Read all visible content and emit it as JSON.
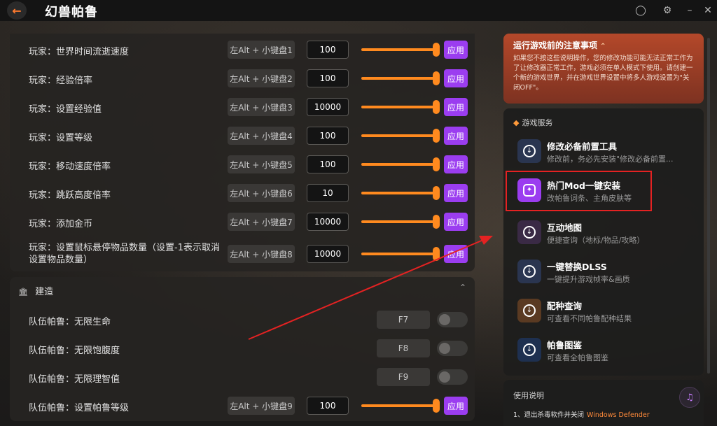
{
  "app": {
    "title": "幻兽帕鲁",
    "back_icon": "arrow-left-icon"
  },
  "player_rows": [
    {
      "label": "玩家：世界时间流逝速度",
      "hotkey": "左Alt + 小键盘1",
      "value": "100",
      "apply": "应用"
    },
    {
      "label": "玩家：经验倍率",
      "hotkey": "左Alt + 小键盘2",
      "value": "100",
      "apply": "应用"
    },
    {
      "label": "玩家：设置经验值",
      "hotkey": "左Alt + 小键盘3",
      "value": "10000",
      "apply": "应用"
    },
    {
      "label": "玩家：设置等级",
      "hotkey": "左Alt + 小键盘4",
      "value": "100",
      "apply": "应用"
    },
    {
      "label": "玩家：移动速度倍率",
      "hotkey": "左Alt + 小键盘5",
      "value": "100",
      "apply": "应用"
    },
    {
      "label": "玩家：跳跃高度倍率",
      "hotkey": "左Alt + 小键盘6",
      "value": "10",
      "apply": "应用"
    },
    {
      "label": "玩家：添加金币",
      "hotkey": "左Alt + 小键盘7",
      "value": "10000",
      "apply": "应用"
    },
    {
      "label": "玩家：设置鼠标悬停物品数量（设置-1表示取消设置物品数量）",
      "hotkey": "左Alt + 小键盘8",
      "value": "10000",
      "apply": "应用"
    }
  ],
  "build_section": {
    "title": "建造",
    "rows": [
      {
        "label": "队伍帕鲁：无限生命",
        "hotkey": "F7"
      },
      {
        "label": "队伍帕鲁：无限饱腹度",
        "hotkey": "F8"
      },
      {
        "label": "队伍帕鲁：无限理智值",
        "hotkey": "F9"
      }
    ],
    "level_row": {
      "label": "队伍帕鲁：设置帕鲁等级",
      "hotkey": "左Alt + 小键盘9",
      "value": "100",
      "apply": "应用"
    }
  },
  "notice": {
    "title": "运行游戏前的注意事项",
    "text": "如果您不按这些说明操作，您的修改功能可能无法正常工作为了让修改器正常工作，游戏必须在单人模式下使用。请创建一个新的游戏世界，并在游戏世界设置中将多人游戏设置为\"关闭OFF\"。"
  },
  "services": {
    "title": "游戏服务",
    "items": [
      {
        "name": "修改必备前置工具",
        "desc": "修改前，务必先安装\"修改必备前置...",
        "color": "#2a3550"
      },
      {
        "name": "热门Mod一键安装",
        "desc": "改帕鲁词条、主角皮肤等",
        "color": "#9b3df0"
      },
      {
        "name": "互动地图",
        "desc": "便捷查询（地标/物品/攻略）",
        "color": "#3a2a45"
      },
      {
        "name": "一键替换DLSS",
        "desc": "一键提升游戏帧率&画质",
        "color": "#2a3550"
      },
      {
        "name": "配种查询",
        "desc": "可查看不同帕鲁配种结果",
        "color": "#5a3a22"
      },
      {
        "name": "帕鲁图鉴",
        "desc": "可查看全帕鲁图鉴",
        "color": "#1e3050"
      }
    ]
  },
  "usage": {
    "title": "使用说明",
    "item_prefix": "1、退出杀毒软件并关闭",
    "item_accent": "Windows Defender"
  },
  "colors": {
    "accent_orange": "#ff8a1f",
    "apply_purple": "#9b3df0",
    "highlight_red": "#e42222"
  }
}
